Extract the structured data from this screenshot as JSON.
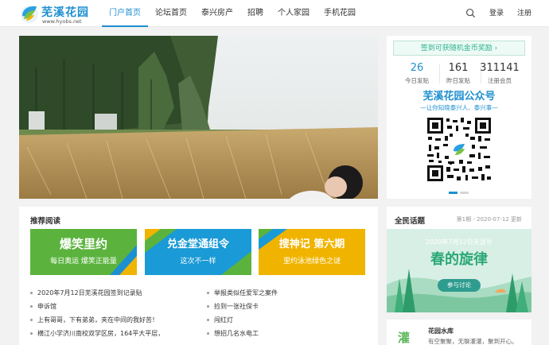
{
  "header": {
    "logo_text": "芜溪花园",
    "logo_url": "www.hyobs.net",
    "nav": [
      "门户首页",
      "论坛首页",
      "泰兴房产",
      "招聘",
      "个人家园",
      "手机花园"
    ],
    "login": "登录",
    "register": "注册",
    "accent": "#1e8fd0"
  },
  "sign": {
    "button": "签到可获随机金币奖励 ›",
    "stats": [
      {
        "num": "26",
        "label": "今日发贴"
      },
      {
        "num": "161",
        "label": "昨日发贴"
      },
      {
        "num": "311141",
        "label": "注册会员"
      }
    ],
    "qr_title": "芜溪花园公众号",
    "qr_sub": "—让你知晓泰兴人、泰兴事—"
  },
  "reco": {
    "title": "推荐阅读",
    "cards": [
      {
        "title": "爆笑里约",
        "sub": "每日奥运  爆笑正能量",
        "color": "#5bb33e"
      },
      {
        "title": "兑金堂通组令",
        "sub": "这次不一样",
        "color": "#1a9ad6"
      },
      {
        "title": "搜神记 第六期",
        "sub": "里约泳池绿色之谜",
        "color": "#f0b400"
      }
    ],
    "list_left": [
      "2020年7月12日芜溪花园签到记录贴",
      "申诉馆",
      "上有哥哥，下有弟弟，夹在中间的我好苦！",
      "横江小学济川南校双学区房，164平大平层，"
    ],
    "list_right": [
      "举报类似任爱军之案件",
      "捡到一张社保卡",
      "闯红灯",
      "想招几名水电工"
    ]
  },
  "topic": {
    "title": "全民话题",
    "meta": "第1期 - 2020-07-12 更新",
    "date": "2020年7月12日天涯号",
    "big": "春的旋律",
    "button": "参与讨论"
  },
  "water": {
    "icon": "灌",
    "name": "花园水库",
    "desc": "有空聚聚，无聊灌灌，聚到开心。"
  }
}
